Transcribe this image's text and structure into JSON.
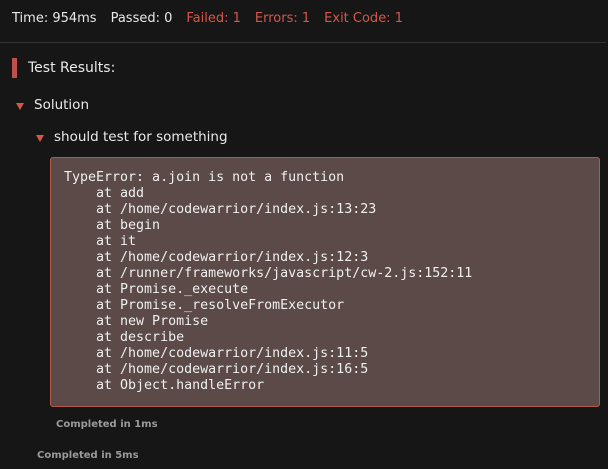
{
  "status": {
    "time": "Time: 954ms",
    "passed": "Passed: 0",
    "failed": "Failed: 1",
    "errors": "Errors: 1",
    "exit_code": "Exit Code: 1"
  },
  "colors": {
    "background": "#161616",
    "error_red": "#d4574a",
    "error_box_bg": "#5b4a48",
    "error_box_border": "#b4584c"
  },
  "results": {
    "heading": "Test Results:",
    "suite": {
      "label": "Solution",
      "test": {
        "label": "should test for something",
        "error_lines": [
          "TypeError: a.join is not a function",
          "    at add",
          "    at /home/codewarrior/index.js:13:23",
          "    at begin",
          "    at it",
          "    at /home/codewarrior/index.js:12:3",
          "    at /runner/frameworks/javascript/cw-2.js:152:11",
          "    at Promise._execute",
          "    at Promise._resolveFromExecutor",
          "    at new Promise",
          "    at describe",
          "    at /home/codewarrior/index.js:11:5",
          "    at /home/codewarrior/index.js:16:5",
          "    at Object.handleError"
        ],
        "completed": "Completed in 1ms"
      },
      "completed": "Completed in 5ms"
    }
  }
}
